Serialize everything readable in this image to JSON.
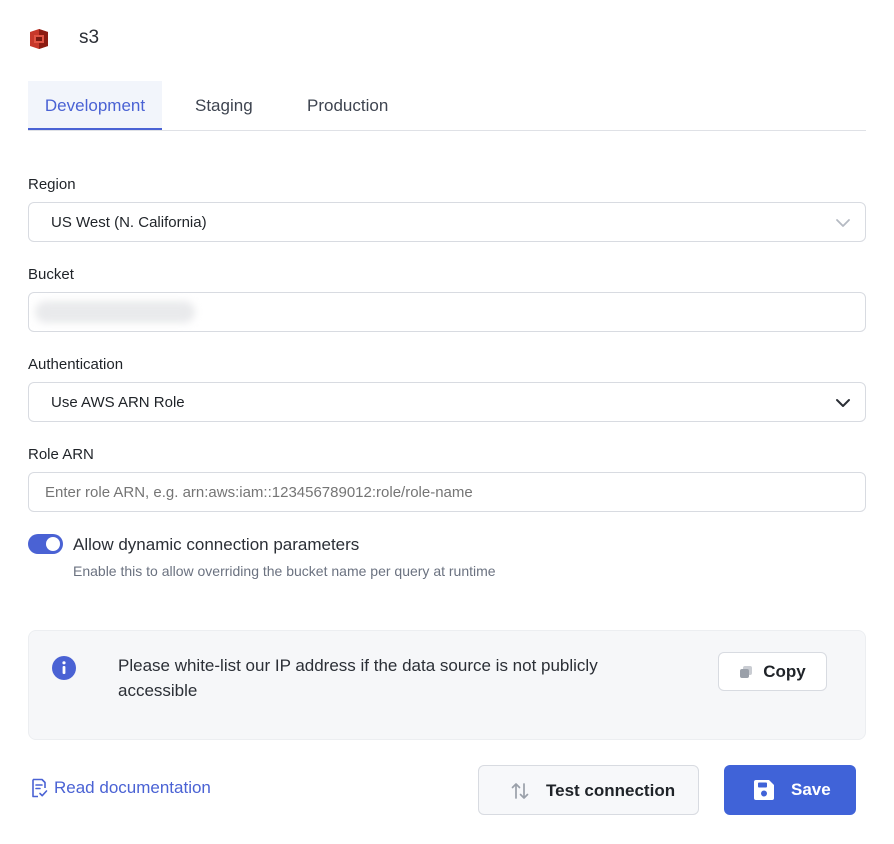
{
  "header": {
    "logo_icon": "aws-s3-logo-icon",
    "title": "s3"
  },
  "tabs": [
    {
      "label": "Development",
      "active": true
    },
    {
      "label": "Staging",
      "active": false
    },
    {
      "label": "Production",
      "active": false
    }
  ],
  "form": {
    "region": {
      "label": "Region",
      "value": "US West (N. California)"
    },
    "bucket": {
      "label": "Bucket",
      "value_obscured": true
    },
    "authentication": {
      "label": "Authentication",
      "value": "Use AWS ARN Role"
    },
    "role_arn": {
      "label": "Role ARN",
      "value": "",
      "placeholder": "Enter role ARN, e.g. arn:aws:iam::123456789012:role/role-name"
    },
    "dynamic_params": {
      "label": "Allow dynamic connection parameters",
      "help": "Enable this to allow overriding the bucket name per query at runtime",
      "enabled": true
    }
  },
  "callout": {
    "icon": "info-icon",
    "text": "Please white-list our IP address if the data source is not publicly accessible",
    "copy_label": "Copy"
  },
  "footer": {
    "doc_link": "Read documentation",
    "test_label": "Test connection",
    "save_label": "Save"
  },
  "colors": {
    "accent": "#4a62d4",
    "save_button": "#4063d8",
    "logo_red": "#c7382b"
  }
}
